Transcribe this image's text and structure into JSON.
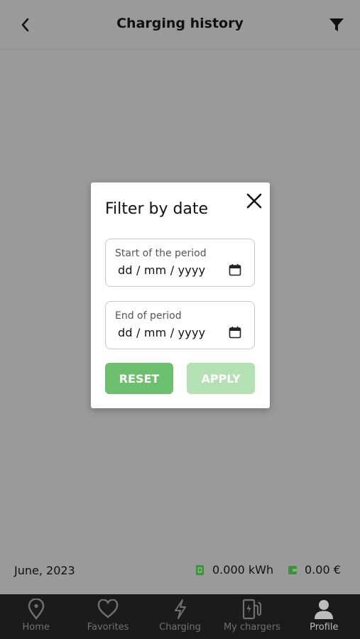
{
  "header": {
    "title": "Charging history",
    "back_icon": "chevron-left-icon",
    "filter_icon": "funnel-icon"
  },
  "summary": {
    "month": "June, 2023",
    "energy": "0.000 kWh",
    "cost": "0.00 €",
    "energy_icon": "charger-icon",
    "cost_icon": "wallet-icon",
    "accent_color": "#4caf50"
  },
  "modal": {
    "title": "Filter by date",
    "close_icon": "close-icon",
    "start": {
      "label": "Start of the period",
      "value": "dd / mm / yyyy"
    },
    "end": {
      "label": "End of period",
      "value": "dd / mm / yyyy"
    },
    "reset_label": "RESET",
    "apply_label": "APPLY",
    "reset_color": "#6cbf6c",
    "apply_color": "#b3e1b3"
  },
  "nav": {
    "items": [
      {
        "label": "Home",
        "icon": "map-pin-icon"
      },
      {
        "label": "Favorites",
        "icon": "heart-icon"
      },
      {
        "label": "Charging",
        "icon": "lightning-icon"
      },
      {
        "label": "My chargers",
        "icon": "charger-station-icon"
      },
      {
        "label": "Profile",
        "icon": "person-icon"
      }
    ]
  }
}
